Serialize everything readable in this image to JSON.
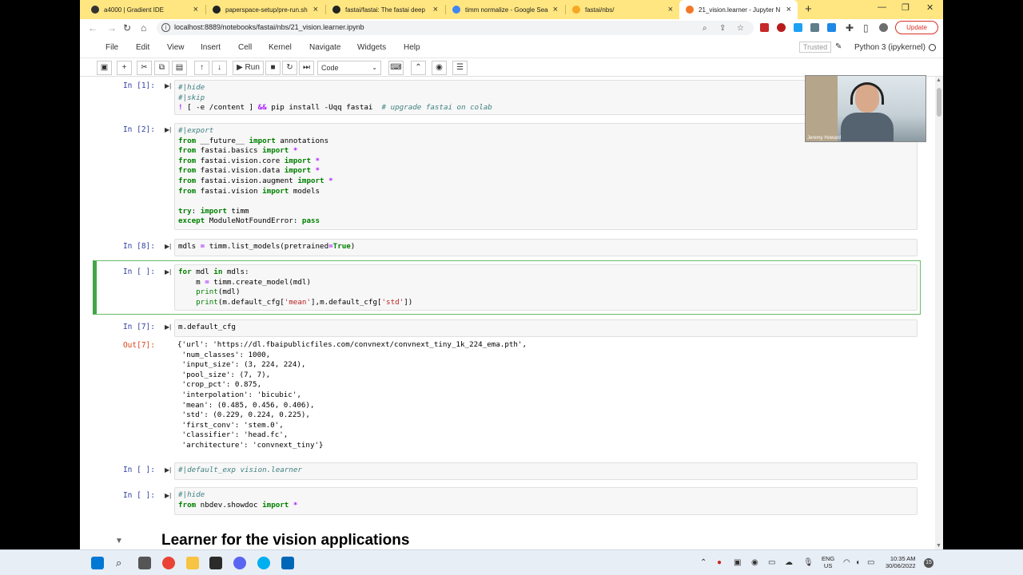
{
  "browser": {
    "tabs": [
      {
        "label": "a4000 | Gradient IDE",
        "icon_color": "#333333"
      },
      {
        "label": "paperspace-setup/pre-run.sh",
        "icon_color": "#222222"
      },
      {
        "label": "fastai/fastai: The fastai deep",
        "icon_color": "#222222"
      },
      {
        "label": "timm normalize - Google Sea",
        "icon_color": "#4285f4"
      },
      {
        "label": "fastai/nbs/",
        "icon_color": "#f5a623"
      },
      {
        "label": "21_vision.learner - Jupyter N",
        "icon_color": "#f37726"
      }
    ],
    "new_tab": "+",
    "url": "localhost:8889/notebooks/fastai/nbs/21_vision.learner.ipynb",
    "update_label": "Update"
  },
  "jupyter": {
    "menu": [
      "File",
      "Edit",
      "View",
      "Insert",
      "Cell",
      "Kernel",
      "Navigate",
      "Widgets",
      "Help"
    ],
    "trusted": "Trusted",
    "kernel": "Python 3 (ipykernel)",
    "run_label": "Run",
    "cell_type": "Code"
  },
  "cells": {
    "c1": {
      "prompt": "In [1]:"
    },
    "c2": {
      "prompt": "In [2]:"
    },
    "c3": {
      "prompt": "In [8]:"
    },
    "c4": {
      "prompt": "In [ ]:"
    },
    "c5": {
      "prompt": "In [7]:",
      "out_prompt": "Out[7]:"
    },
    "c6": {
      "prompt": "In [ ]:"
    },
    "c7": {
      "prompt": "In [ ]:"
    }
  },
  "output": {
    "lines": [
      "{'url': 'https://dl.fbaipublicfiles.com/convnext/convnext_tiny_1k_224_ema.pth',",
      " 'num_classes': 1000,",
      " 'input_size': (3, 224, 224),",
      " 'pool_size': (7, 7),",
      " 'crop_pct': 0.875,",
      " 'interpolation': 'bicubic',",
      " 'mean': (0.485, 0.456, 0.406),",
      " 'std': (0.229, 0.224, 0.225),",
      " 'first_conv': 'stem.0',",
      " 'classifier': 'head.fc',",
      " 'architecture': 'convnext_tiny'}"
    ]
  },
  "heading": "Learner for the vision applications",
  "webcam": {
    "caption": "Jeremy Howard"
  },
  "taskbar": {
    "lang_top": "ENG",
    "lang_bottom": "US",
    "time": "10:35 AM",
    "date": "30/06/2022",
    "notifications": "15"
  }
}
